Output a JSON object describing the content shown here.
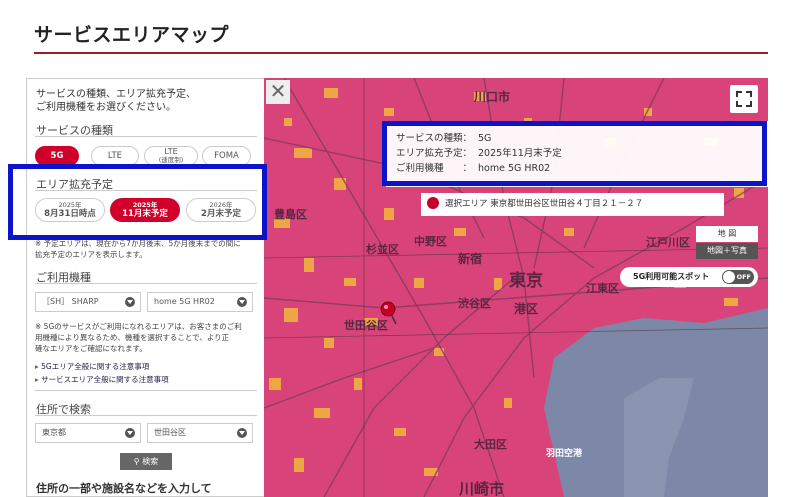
{
  "page": {
    "title": "サービスエリアマップ"
  },
  "panel": {
    "intro": "サービスの種類、エリア拡充予定、\nご利用機種をお選びください。",
    "service_section": "サービスの種類",
    "services": [
      {
        "label": "5G",
        "active": true
      },
      {
        "label": "LTE",
        "active": false
      },
      {
        "label_top": "LTE",
        "label_bottom": "(速度制)",
        "active": false
      },
      {
        "label": "FOMA",
        "active": false
      }
    ],
    "expansion_section": "エリア拡充予定",
    "expansion": [
      {
        "year": "2025年",
        "label": "8月31日時点",
        "active": false
      },
      {
        "year": "2025年",
        "label": "11月末予定",
        "active": true
      },
      {
        "year": "2026年",
        "label": "2月末予定",
        "active": false
      }
    ],
    "expansion_note": "※ 予定エリアは、現在から7か月後末、5か月後末までの間に\n拡充予定のエリアを表示します。",
    "device_section": "ご利用機種",
    "maker_select": "［SH］ SHARP",
    "model_select": "home 5G HR02",
    "device_note": "※ 5Gのサービスがご利用になれるエリアは、お客さまのご利\n用機種により異なるため、機種を選択することで、より正\n確なエリアをご確認になれます。",
    "link1": "5Gエリア全般に関する注意事項",
    "link2": "サービスエリア全般に関する注意事項",
    "address_section": "住所で検索",
    "prefecture_select": "東京都",
    "city_select": "世田谷区",
    "search_button": "検索",
    "bottom_text": "住所の一部や施設名などを入力して"
  },
  "map": {
    "info": {
      "service_key": "サービスの種類：",
      "service_val": "5G",
      "expansion_key": "エリア拡充予定：",
      "expansion_val": "2025年11月末予定",
      "device_key": "ご利用機種　　：",
      "device_val": "home 5G HR02"
    },
    "selected_area": "選択エリア  東京都世田谷区世田谷４丁目２１－２７",
    "map_type": "地 図",
    "map_photo": "地図＋写真",
    "spot_label": "5G利用可能スポット",
    "spot_state": "OFF",
    "labels": {
      "kawaguchi": "川口市",
      "tokyo": "東京",
      "shinjuku": "新宿",
      "shibuya": "渋谷区",
      "setagaya": "世田谷区",
      "minato": "港区",
      "koto": "江東区",
      "edogawa": "江戸川区",
      "suginami": "杉並区",
      "nakano": "中野区",
      "toshima": "豊島区",
      "ota": "大田区",
      "haneda": "羽田空港",
      "kawasaki": "川崎市"
    }
  },
  "colors": {
    "brand": "#d1002b",
    "coverage": "#d8447a",
    "sea": "#7d87a8",
    "highlight": "#0b14c9"
  }
}
